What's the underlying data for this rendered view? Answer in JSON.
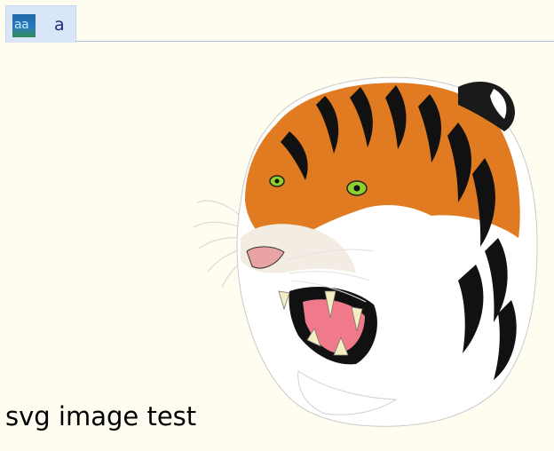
{
  "tabs": [
    {
      "label": "a",
      "icon": "image-favicon-icon",
      "favicon_text": "aa",
      "active": true
    }
  ],
  "content": {
    "image": {
      "icon": "tiger-head-icon"
    },
    "caption": "svg image test"
  },
  "colors": {
    "background": "#fefdf0",
    "tab_background": "#d9e6f7",
    "tab_rule": "#a9bde6",
    "tab_text": "#1e2d7a"
  }
}
